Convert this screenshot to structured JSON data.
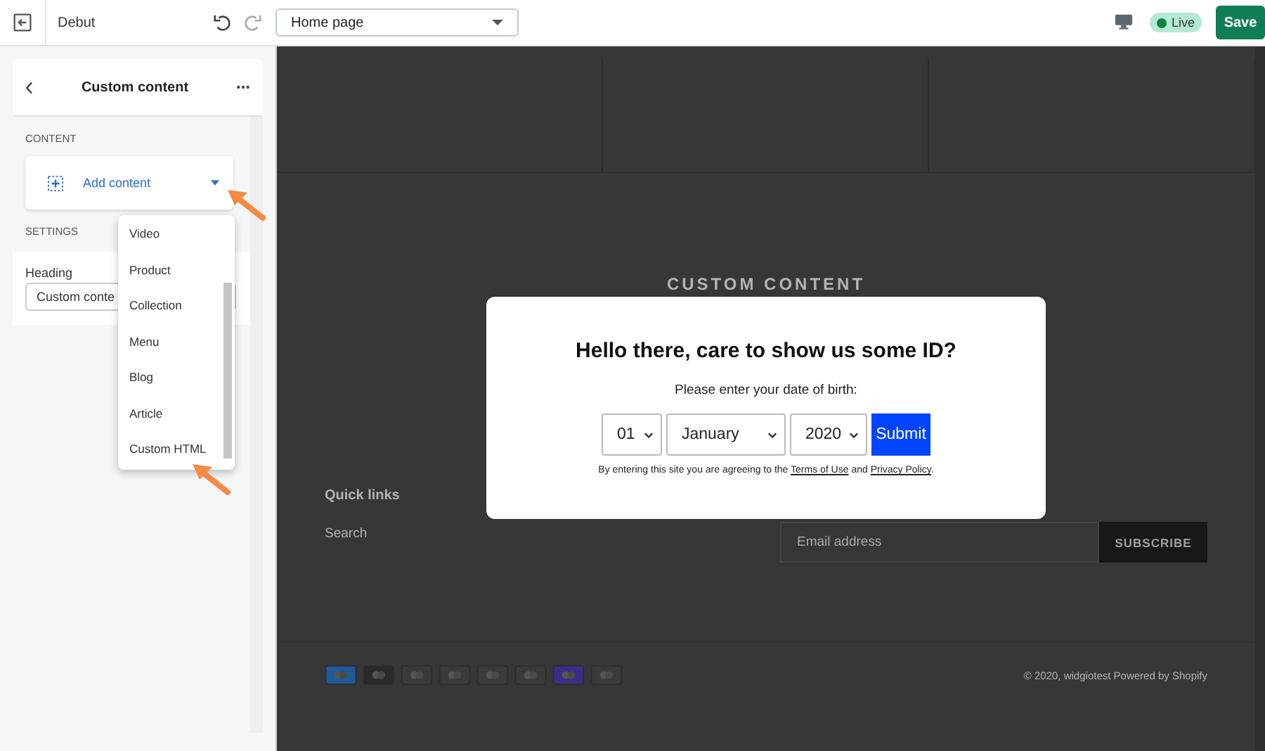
{
  "toolbar": {
    "theme_name": "Debut",
    "page_select": {
      "value": "Home page"
    },
    "live_badge": "Live",
    "save_button": "Save"
  },
  "sidebar": {
    "title": "Custom content",
    "content_label": "CONTENT",
    "add_content": "Add content",
    "settings_label": "SETTINGS",
    "heading_label": "Heading",
    "heading_value": "Custom conte",
    "menu": [
      "Video",
      "Product",
      "Collection",
      "Menu",
      "Blog",
      "Article",
      "Custom HTML"
    ]
  },
  "preview": {
    "section_title": "CUSTOM CONTENT",
    "quick_links_title": "Quick links",
    "quick_links": [
      "Search"
    ],
    "email_placeholder": "Email address",
    "subscribe_button": "SUBSCRIBE",
    "copyright": "© 2020, widgiotest Powered by Shopify"
  },
  "modal": {
    "title": "Hello there, care to show us some ID?",
    "prompt": "Please enter your date of birth:",
    "day": "01",
    "month": "January",
    "year": "2020",
    "submit": "Submit",
    "disclaimer": [
      {
        "kind": "text",
        "text": "By entering this site you are agreeing to the "
      },
      {
        "kind": "link",
        "text": "Terms of Use"
      },
      {
        "kind": "text",
        "text": " and "
      },
      {
        "kind": "link",
        "text": "Privacy Policy"
      },
      {
        "kind": "text",
        "text": "."
      }
    ]
  }
}
